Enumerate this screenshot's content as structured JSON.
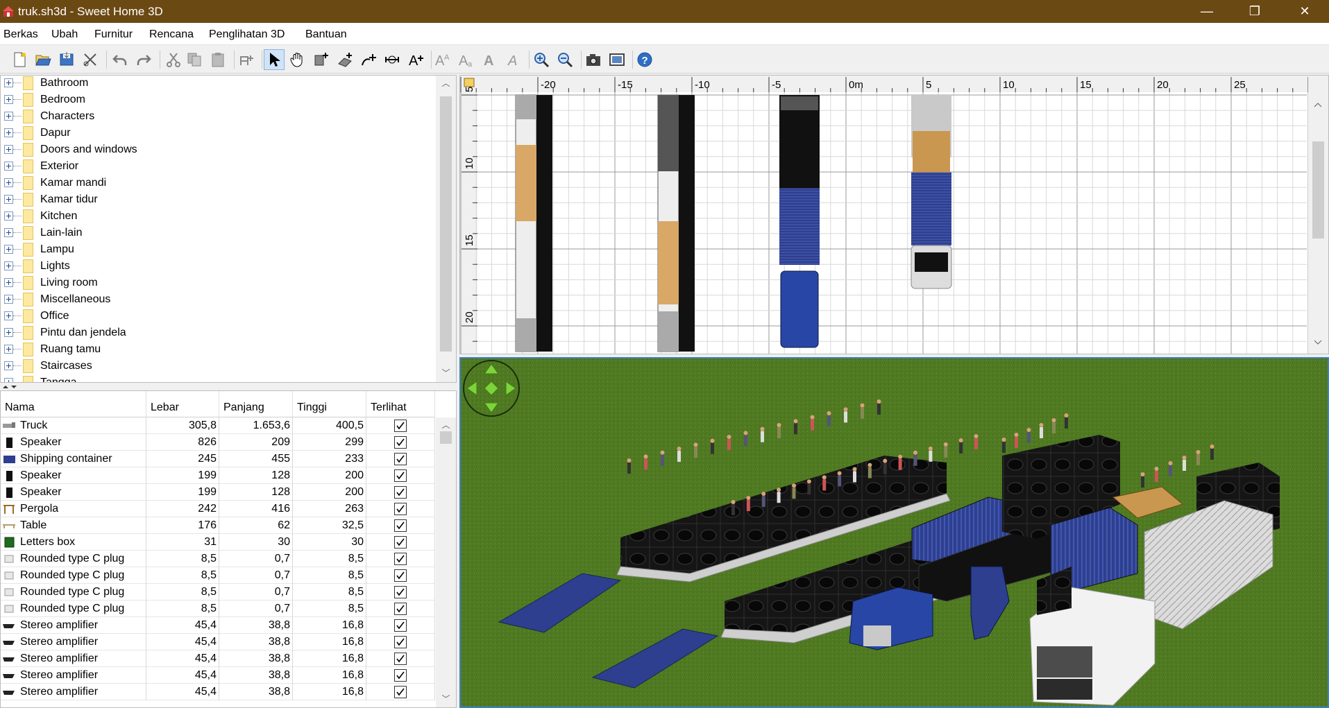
{
  "window": {
    "title": "truk.sh3d - Sweet Home 3D",
    "minimize": "—",
    "restore": "❐",
    "close": "✕"
  },
  "menu": [
    "Berkas",
    "Ubah",
    "Furnitur",
    "Rencana",
    "Penglihatan 3D",
    "Bantuan"
  ],
  "toolbar": {
    "buttons": [
      "new-home",
      "open",
      "save",
      "preferences",
      "undo",
      "redo",
      "cut",
      "copy",
      "paste",
      "add-furniture",
      "select-mode",
      "pan-mode",
      "create-rooms",
      "create-walls",
      "create-polylines",
      "create-dimensions",
      "add-text",
      "increase-text",
      "decrease-text",
      "bold-text",
      "italic-text",
      "zoom-in",
      "zoom-out",
      "create-photo",
      "create-video",
      "help"
    ],
    "selected": "select-mode"
  },
  "catalog": {
    "categories": [
      "Bathroom",
      "Bedroom",
      "Characters",
      "Dapur",
      "Doors and windows",
      "Exterior",
      "Kamar mandi",
      "Kamar tidur",
      "Kitchen",
      "Lain-lain",
      "Lampu",
      "Lights",
      "Living room",
      "Miscellaneous",
      "Office",
      "Pintu dan jendela",
      "Ruang tamu",
      "Staircases",
      "Tangga"
    ]
  },
  "furniture_table": {
    "headers": [
      "Nama",
      "Lebar",
      "Panjang",
      "Tinggi",
      "Terlihat"
    ],
    "rows": [
      {
        "icon": "truck-icon",
        "name": "Truck",
        "width": "305,8",
        "depth": "1.653,6",
        "height": "400,5",
        "visible": true
      },
      {
        "icon": "speaker-icon",
        "name": "Speaker",
        "width": "826",
        "depth": "209",
        "height": "299",
        "visible": true
      },
      {
        "icon": "container-icon",
        "name": "Shipping container",
        "width": "245",
        "depth": "455",
        "height": "233",
        "visible": true
      },
      {
        "icon": "speaker-icon",
        "name": "Speaker",
        "width": "199",
        "depth": "128",
        "height": "200",
        "visible": true
      },
      {
        "icon": "speaker-icon",
        "name": "Speaker",
        "width": "199",
        "depth": "128",
        "height": "200",
        "visible": true
      },
      {
        "icon": "pergola-icon",
        "name": "Pergola",
        "width": "242",
        "depth": "416",
        "height": "263",
        "visible": true
      },
      {
        "icon": "table-icon",
        "name": "Table",
        "width": "176",
        "depth": "62",
        "height": "32,5",
        "visible": true
      },
      {
        "icon": "box-icon",
        "name": "Letters box",
        "width": "31",
        "depth": "30",
        "height": "30",
        "visible": true
      },
      {
        "icon": "plug-icon",
        "name": "Rounded type C plug",
        "width": "8,5",
        "depth": "0,7",
        "height": "8,5",
        "visible": true
      },
      {
        "icon": "plug-icon",
        "name": "Rounded type C plug",
        "width": "8,5",
        "depth": "0,7",
        "height": "8,5",
        "visible": true
      },
      {
        "icon": "plug-icon",
        "name": "Rounded type C plug",
        "width": "8,5",
        "depth": "0,7",
        "height": "8,5",
        "visible": true
      },
      {
        "icon": "plug-icon",
        "name": "Rounded type C plug",
        "width": "8,5",
        "depth": "0,7",
        "height": "8,5",
        "visible": true
      },
      {
        "icon": "amplifier-icon",
        "name": "Stereo amplifier",
        "width": "45,4",
        "depth": "38,8",
        "height": "16,8",
        "visible": true
      },
      {
        "icon": "amplifier-icon",
        "name": "Stereo amplifier",
        "width": "45,4",
        "depth": "38,8",
        "height": "16,8",
        "visible": true
      },
      {
        "icon": "amplifier-icon",
        "name": "Stereo amplifier",
        "width": "45,4",
        "depth": "38,8",
        "height": "16,8",
        "visible": true
      },
      {
        "icon": "amplifier-icon",
        "name": "Stereo amplifier",
        "width": "45,4",
        "depth": "38,8",
        "height": "16,8",
        "visible": true
      },
      {
        "icon": "amplifier-icon",
        "name": "Stereo amplifier",
        "width": "45,4",
        "depth": "38,8",
        "height": "16,8",
        "visible": true
      }
    ]
  },
  "plan": {
    "ruler_x_labels": [
      "-20",
      "-15",
      "-10",
      "-5",
      "0m",
      "5",
      "10",
      "15",
      "20",
      "25"
    ],
    "ruler_y_labels": [
      "5",
      "10",
      "15",
      "20"
    ]
  },
  "colors": {
    "titlebar": "#6b4913",
    "selection": "#3c7fc9",
    "grass": "#4f7a22",
    "container_blue": "#2e3f8f"
  }
}
